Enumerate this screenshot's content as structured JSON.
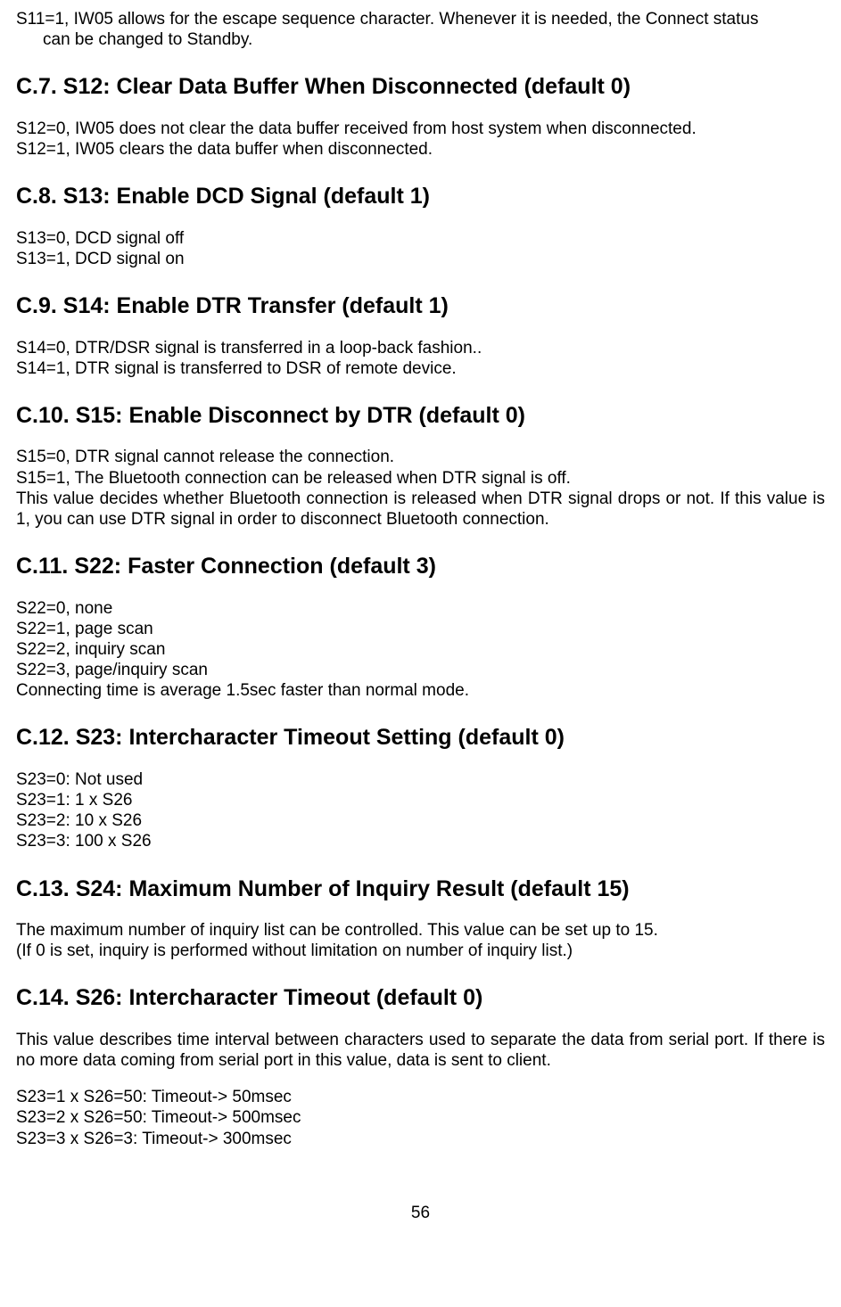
{
  "intro": {
    "line1": "S11=1, IW05 allows for the escape sequence character. Whenever it is needed, the Connect status",
    "line2": "can be changed to Standby."
  },
  "sections": {
    "c7": {
      "title": "C.7. S12: Clear Data Buffer When Disconnected (default 0)",
      "l1": "S12=0, IW05 does not clear the data buffer received from host system when disconnected.",
      "l2": "S12=1, IW05 clears the data buffer when disconnected."
    },
    "c8": {
      "title": "C.8. S13: Enable DCD Signal (default 1)",
      "l1": "S13=0, DCD signal off",
      "l2": "S13=1, DCD signal on"
    },
    "c9": {
      "title": "C.9. S14: Enable DTR Transfer (default 1)",
      "l1": "S14=0, DTR/DSR signal is transferred in a loop-back fashion..",
      "l2": "S14=1, DTR signal is transferred to DSR of remote device."
    },
    "c10": {
      "title": "C.10. S15: Enable Disconnect by DTR (default 0)",
      "l1": "S15=0, DTR signal cannot release the connection.",
      "l2": "S15=1, The Bluetooth connection can be released when DTR signal is off.",
      "l3": "This value decides whether Bluetooth connection is released when DTR signal drops or not. If this value is 1, you can use DTR signal in order to disconnect Bluetooth connection."
    },
    "c11": {
      "title": "C.11. S22: Faster Connection (default 3)",
      "l1": "S22=0, none",
      "l2": "S22=1, page scan",
      "l3": "S22=2, inquiry scan",
      "l4": "S22=3, page/inquiry scan",
      "l5": "Connecting time is average 1.5sec faster than normal mode."
    },
    "c12": {
      "title": "C.12. S23: Intercharacter Timeout Setting (default 0)",
      "l1": "S23=0: Not used",
      "l2": "S23=1: 1 x S26",
      "l3": "S23=2: 10 x S26",
      "l4": "S23=3: 100 x S26"
    },
    "c13": {
      "title": "C.13. S24: Maximum Number of Inquiry Result (default 15)",
      "l1": "The maximum number of inquiry list can be controlled. This value can be set up to 15.",
      "l2": "(If 0 is set, inquiry is performed without limitation on number of inquiry list.)"
    },
    "c14": {
      "title": "C.14. S26: Intercharacter Timeout (default 0)",
      "l1": "This value describes time interval between characters used to separate the data from serial port. If there is no more data coming from serial port in this value, data is sent to client.",
      "l2": "S23=1 x S26=50: Timeout-> 50msec",
      "l3": "S23=2 x S26=50: Timeout-> 500msec",
      "l4": "S23=3 x S26=3: Timeout-> 300msec"
    }
  },
  "pageNumber": "56"
}
